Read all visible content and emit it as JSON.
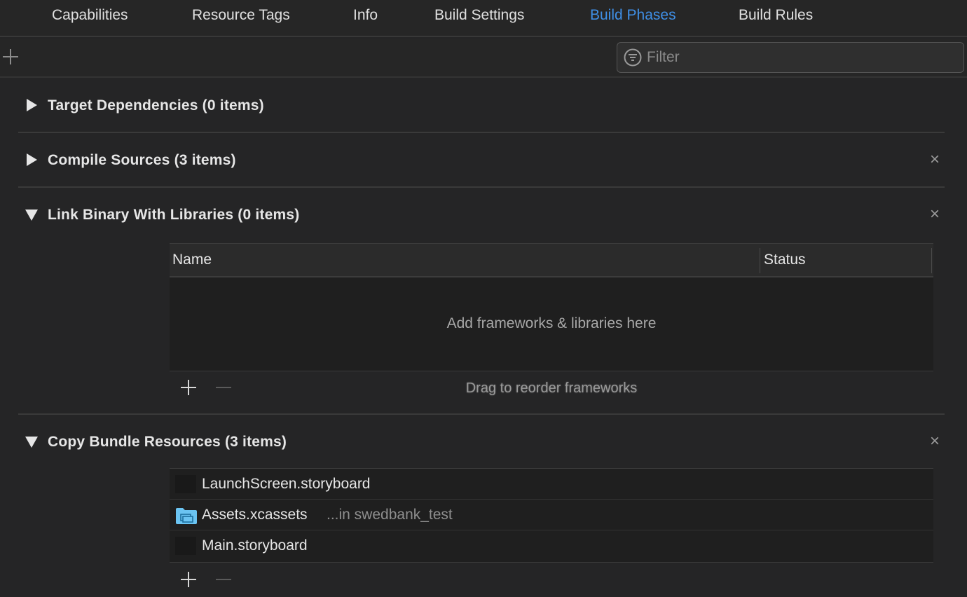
{
  "tabs": [
    {
      "label": "Capabilities"
    },
    {
      "label": "Resource Tags"
    },
    {
      "label": "Info"
    },
    {
      "label": "Build Settings"
    },
    {
      "label": "Build Phases",
      "active": true
    },
    {
      "label": "Build Rules"
    }
  ],
  "toolbar": {
    "add_icon": "plus-icon",
    "filter_placeholder": "Filter",
    "filter_value": ""
  },
  "phases": [
    {
      "title": "Target Dependencies (0 items)",
      "expanded": false,
      "removable": false
    },
    {
      "title": "Compile Sources (3 items)",
      "expanded": false,
      "removable": true
    },
    {
      "title": "Link Binary With Libraries (0 items)",
      "expanded": true,
      "removable": true,
      "columns": [
        "Name",
        "Status"
      ],
      "empty_text": "Add frameworks & libraries here",
      "hint": "Drag to reorder frameworks"
    },
    {
      "title": "Copy Bundle Resources (3 items)",
      "expanded": true,
      "removable": true,
      "items": [
        {
          "name": "LaunchScreen.storyboard",
          "location": "",
          "icon": "storyboard-icon"
        },
        {
          "name": "Assets.xcassets",
          "location": "...in swedbank_test",
          "icon": "folder-icon"
        },
        {
          "name": "Main.storyboard",
          "location": "",
          "icon": "storyboard-icon"
        }
      ]
    }
  ],
  "colors": {
    "accent": "#3f8fe6",
    "background": "#252526",
    "text": "#e6e6e6",
    "folder": "#6bc4f2"
  }
}
